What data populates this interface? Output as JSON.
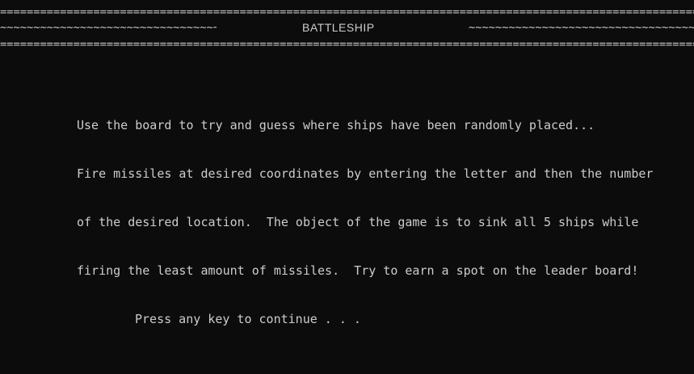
{
  "header": {
    "rule": "===============================================================================================================",
    "tildes_left": "~~~~~~~~~~~~~~~~~~~~~~~~~~~~~~~~~~~~~~~",
    "tildes_right": "~~~~~~~~~~~~~~~~~~~~~~~~~~~~~~~~~~~~~~~~~",
    "title": "BATTLESHIP"
  },
  "instructions": {
    "line_1": "Use the board to try and guess where ships have been randomly placed...",
    "line_2": "Fire missiles at desired coordinates by entering the letter and then the number",
    "line_3": "of the desired location.  The object of the game is to sink all 5 ships while",
    "line_4": "firing the least amount of missiles.  Try to earn a spot on the leader board!"
  },
  "prompt": "Press any key to continue . . .",
  "colors": {
    "background": "#0c0c0c",
    "text": "#cccccc"
  }
}
